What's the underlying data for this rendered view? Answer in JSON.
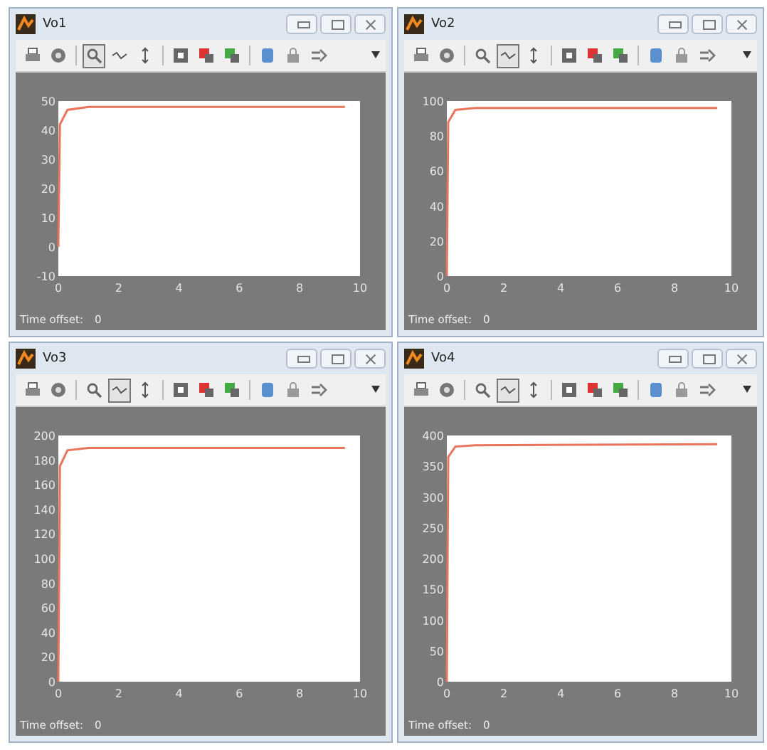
{
  "windows": [
    {
      "title": "Vo1",
      "zoom_pressed": true,
      "zoom_x_pressed": false,
      "time_offset_label": "Time offset:",
      "time_offset_value": "0",
      "chart_data": {
        "type": "line",
        "x": [
          0,
          0.05,
          0.3,
          1,
          9.5
        ],
        "values": [
          0,
          42,
          47,
          48,
          48
        ],
        "xlim": [
          0,
          10
        ],
        "ylim": [
          -10,
          50
        ],
        "xticks": [
          0,
          2,
          4,
          6,
          8,
          10
        ],
        "yticks": [
          -10,
          0,
          10,
          20,
          30,
          40,
          50
        ]
      }
    },
    {
      "title": "Vo2",
      "zoom_pressed": false,
      "zoom_x_pressed": true,
      "time_offset_label": "Time offset:",
      "time_offset_value": "0",
      "chart_data": {
        "type": "line",
        "x": [
          0,
          0.05,
          0.3,
          1,
          9.5
        ],
        "values": [
          0,
          88,
          95,
          96,
          96
        ],
        "xlim": [
          0,
          10
        ],
        "ylim": [
          0,
          100
        ],
        "xticks": [
          0,
          2,
          4,
          6,
          8,
          10
        ],
        "yticks": [
          0,
          20,
          40,
          60,
          80,
          100
        ]
      }
    },
    {
      "title": "Vo3",
      "zoom_pressed": false,
      "zoom_x_pressed": true,
      "time_offset_label": "Time offset:",
      "time_offset_value": "0",
      "chart_data": {
        "type": "line",
        "x": [
          0,
          0.05,
          0.3,
          1,
          9.5
        ],
        "values": [
          0,
          175,
          188,
          190,
          190
        ],
        "xlim": [
          0,
          10
        ],
        "ylim": [
          0,
          200
        ],
        "xticks": [
          0,
          2,
          4,
          6,
          8,
          10
        ],
        "yticks": [
          0,
          20,
          40,
          60,
          80,
          100,
          120,
          140,
          160,
          180,
          200
        ]
      }
    },
    {
      "title": "Vo4",
      "zoom_pressed": false,
      "zoom_x_pressed": true,
      "time_offset_label": "Time offset:",
      "time_offset_value": "0",
      "chart_data": {
        "type": "line",
        "x": [
          0,
          0.05,
          0.3,
          1,
          9.5
        ],
        "values": [
          0,
          365,
          382,
          384,
          386
        ],
        "xlim": [
          0,
          10
        ],
        "ylim": [
          0,
          400
        ],
        "xticks": [
          0,
          2,
          4,
          6,
          8,
          10
        ],
        "yticks": [
          0,
          50,
          100,
          150,
          200,
          250,
          300,
          350,
          400
        ]
      }
    }
  ]
}
